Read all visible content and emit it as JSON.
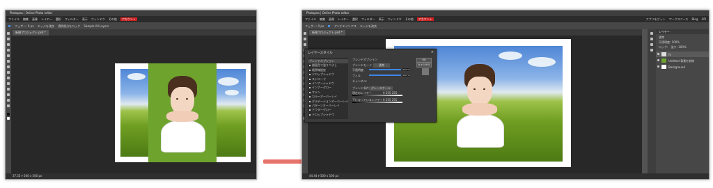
{
  "app": {
    "title": "Photopea | Online Photo editor",
    "menu": [
      "ファイル",
      "編集",
      "画像",
      "レイヤー",
      "選択",
      "フィルター",
      "表示",
      "ウィンドウ",
      "その他",
      "アカウント"
    ],
    "menu_highlight": "アカウント",
    "highlight_color": "#cc2020"
  },
  "left_window": {
    "options": [
      "フェザー: 0 px",
      "エッジを改良",
      "透明部分をロック",
      "Sample All Layers"
    ],
    "tab": "新規プロジェクト.psd *",
    "status": "37.55 ▾ 500 x 500 px"
  },
  "right_window": {
    "options": [
      "フェザー: 0 px",
      "アンチエイリアス",
      "エッジを改良"
    ],
    "tab": "新規プロジェクト.psd *",
    "status": "44.44 ▾ 500 x 500 px",
    "top_right_links": [
      "アプリをゲット",
      "ワークスペース",
      "Blog",
      "API"
    ]
  },
  "layer_style_dialog": {
    "title": "レイヤースタイル",
    "close": "×",
    "sections": [
      "ブレンドオプション",
      "描画色で塗りつぶし",
      "境界線設定",
      "ドロップシャドウ",
      "ストローク",
      "インナーシャドウ",
      "インナーグロー",
      "サテン",
      "カラーオーバーレイ",
      "グラデーションオーバーレイ",
      "パターンオーバーレイ",
      "アウターグロー",
      "ドロップシャドウ"
    ],
    "panel": {
      "heading": "ブレンドオプション",
      "blend_mode_label": "ブレンドモード",
      "blend_mode": "通常",
      "opacity_label": "不透明度",
      "opacity_value": "100 %",
      "fill_label": "フィル",
      "fill_value": "100 %",
      "channels_label": "チャンネル:",
      "blend_if_label": "ブレンド条件",
      "blend_if_value": "グレースケール",
      "this_layer_label": "現在のレイヤー",
      "this_layer_values": "0   255 255",
      "underlying_label": "下になっているレイヤー",
      "underlying_values": "0   255 255",
      "ok": "OK",
      "cancel": "キャンセル"
    }
  },
  "layers_panel": {
    "tab_label": "レイヤー",
    "blend_mode": "通常",
    "opacity": "不透明度: 100%",
    "fill": "塗り: 100%",
    "lock_label": "ロック:",
    "layers": [
      {
        "name": "fx",
        "selected": true
      },
      {
        "name": "Untitled 背景を削除",
        "selected": false
      },
      {
        "name": "Background",
        "selected": false
      }
    ]
  }
}
